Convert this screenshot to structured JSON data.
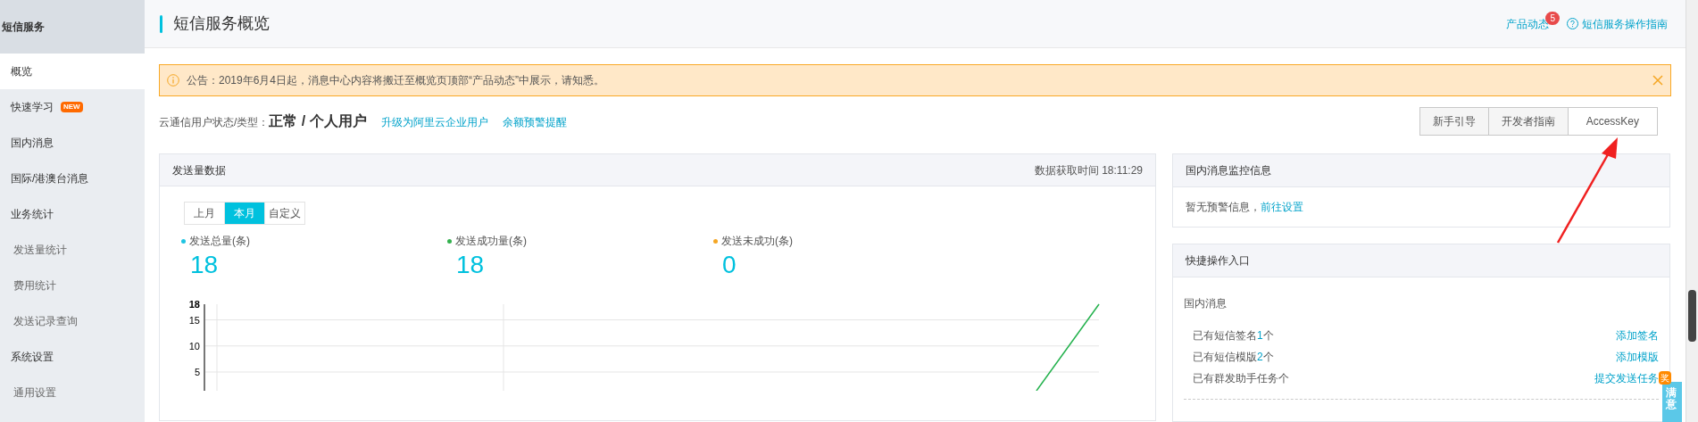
{
  "sidebar": {
    "title": "短信服务",
    "items": [
      {
        "label": "概览",
        "kind": "item",
        "selected": true
      },
      {
        "label": "快速学习",
        "kind": "item",
        "selected": false,
        "badge": "NEW"
      },
      {
        "label": "国内消息",
        "kind": "item",
        "selected": false
      },
      {
        "label": "国际/港澳台消息",
        "kind": "item",
        "selected": false
      },
      {
        "label": "业务统计",
        "kind": "group",
        "selected": false
      },
      {
        "label": "发送量统计",
        "kind": "sub",
        "selected": false
      },
      {
        "label": "费用统计",
        "kind": "sub",
        "selected": false
      },
      {
        "label": "发送记录查询",
        "kind": "sub",
        "selected": false
      },
      {
        "label": "系统设置",
        "kind": "group",
        "selected": false
      },
      {
        "label": "通用设置",
        "kind": "sub",
        "selected": false
      }
    ]
  },
  "header": {
    "title": "短信服务概览",
    "links": [
      {
        "label": "产品动态",
        "badge": "5"
      },
      {
        "label": "短信服务操作指南",
        "kind": "help"
      }
    ]
  },
  "notice": {
    "text": "公告：2019年6月4日起，消息中心内容将搬迁至概览页顶部“产品动态”中展示，请知悉。"
  },
  "status": {
    "label": "云通信用户状态/类型：",
    "value": "正常 / 个人用户",
    "links": [
      "升级为阿里云企业用户",
      "余额预警提醒"
    ]
  },
  "actions": [
    {
      "label": "新手引导",
      "selected": false
    },
    {
      "label": "开发者指南",
      "selected": false
    },
    {
      "label": "AccessKey",
      "selected": true
    }
  ],
  "send_panel": {
    "title": "发送量数据",
    "time": "数据获取时间 18:11:29",
    "tabs": [
      {
        "label": "上月",
        "selected": false
      },
      {
        "label": "本月",
        "selected": true
      },
      {
        "label": "自定义",
        "selected": false
      }
    ],
    "stats": [
      {
        "label": "发送总量(条)",
        "value": "18",
        "color": "#1ec4e2"
      },
      {
        "label": "发送成功量(条)",
        "value": "18",
        "color": "#33b14e"
      },
      {
        "label": "发送未成功(条)",
        "value": "0",
        "color": "#f5a623"
      }
    ],
    "chart": {
      "y_labels": [
        "18",
        "15",
        "10",
        "5"
      ]
    }
  },
  "monitor_panel": {
    "title": "国内消息监控信息",
    "text": "暂无预警信息，",
    "link": "前往设置"
  },
  "quick_panel": {
    "title": "快捷操作入口",
    "section": "国内消息",
    "rows": [
      {
        "text": "已有短信签名",
        "count": "1",
        "unit": "个",
        "action": "添加签名"
      },
      {
        "text": "已有短信模版",
        "count": "2",
        "unit": "个",
        "action": "添加模版"
      },
      {
        "text": "已有群发助手任务个",
        "action": "提交发送任务"
      }
    ]
  },
  "feedback": {
    "label": "满意",
    "badge": "奖"
  }
}
